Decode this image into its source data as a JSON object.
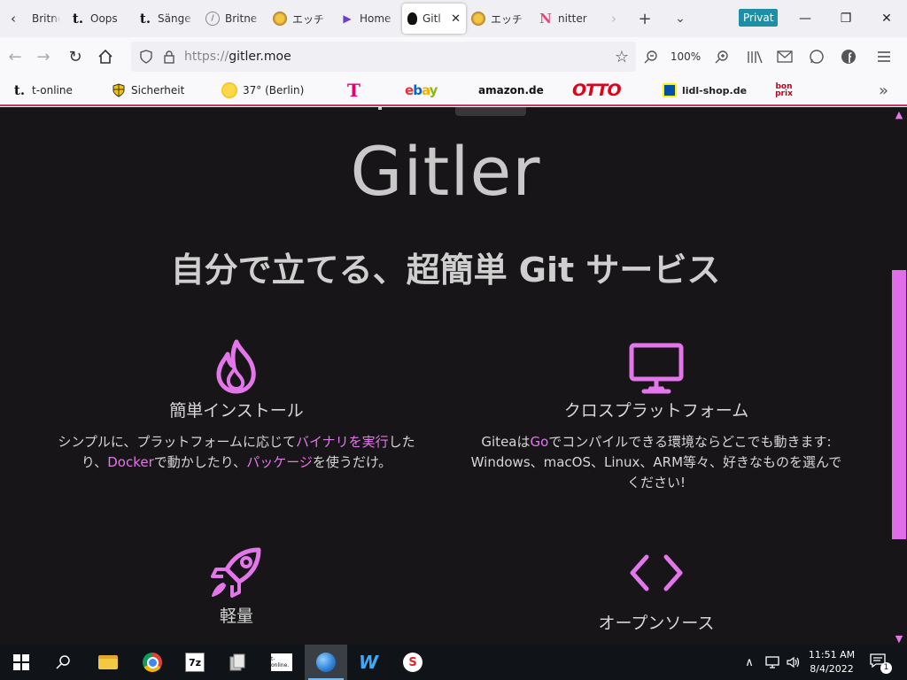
{
  "browser": {
    "tabs": [
      {
        "title": "Britne",
        "favicon": "tab-icon-britney",
        "active": false
      },
      {
        "title": "Oops",
        "favicon": "t-online-icon",
        "active": false
      },
      {
        "title": "Sänge",
        "favicon": "t-online-icon",
        "active": false
      },
      {
        "title": "Britne",
        "favicon": "circle-icon",
        "active": false
      },
      {
        "title": "エッチ",
        "favicon": "anime-icon",
        "active": false
      },
      {
        "title": "Home",
        "favicon": "play-icon",
        "active": false
      },
      {
        "title": "Gitl",
        "favicon": "tux-icon",
        "active": true
      },
      {
        "title": "エッチ",
        "favicon": "anime-icon",
        "active": false
      },
      {
        "title": "nitter",
        "favicon": "nitter-icon",
        "active": false
      }
    ],
    "new_tab_symbol": "+",
    "tab_list_symbol": "⌄",
    "private_badge": "Privat",
    "window_controls": {
      "minimize": "—",
      "restore": "❐",
      "close": "✕"
    },
    "url": {
      "protocol": "https://",
      "host": "gitler.moe"
    },
    "zoom": "100%",
    "bookmarks": [
      {
        "label": "t-online",
        "icon": "t-online-icon"
      },
      {
        "label": "Sicherheit",
        "icon": "shield-icon"
      },
      {
        "label": "37° (Berlin)",
        "icon": "weather-sun-icon"
      },
      {
        "label": "",
        "icon": "telekom-icon",
        "logo": "T"
      },
      {
        "label": "",
        "icon": "ebay-icon",
        "logo": "ebay"
      },
      {
        "label": "",
        "icon": "amazon-icon",
        "logo": "amazon.de"
      },
      {
        "label": "",
        "icon": "otto-icon",
        "logo": "OTTO"
      },
      {
        "label": "lidl-shop.de",
        "icon": "lidl-icon"
      },
      {
        "label": "",
        "icon": "bonprix-icon",
        "logo": "bon prix"
      }
    ],
    "bookmarks_overflow_symbol": "»"
  },
  "page": {
    "title": "Gitler",
    "tagline": "自分で立てる、超簡単 Git サービス",
    "accent_color": "#e276ea",
    "background_color": "#171517",
    "features": [
      {
        "icon": "flame-icon",
        "title": "簡単インストール",
        "desc": [
          {
            "text": "シンプルに、プラットフォームに応じて",
            "hl": false
          },
          {
            "text": "バイナリを実行",
            "hl": true
          },
          {
            "text": "したり、",
            "hl": false
          },
          {
            "text": "Docker",
            "hl": true
          },
          {
            "text": "で動かしたり、",
            "hl": false
          },
          {
            "text": "パッケージ",
            "hl": true
          },
          {
            "text": "を使うだけ。",
            "hl": false
          }
        ]
      },
      {
        "icon": "monitor-icon",
        "title": "クロスプラットフォーム",
        "desc": [
          {
            "text": "Giteaは",
            "hl": false
          },
          {
            "text": "Go",
            "hl": true
          },
          {
            "text": "でコンパイルできる環境ならどこでも動きます: Windows、macOS、Linux、ARM等々、好きなものを選んでください!",
            "hl": false
          }
        ]
      },
      {
        "icon": "rocket-icon",
        "title": "軽量",
        "desc": []
      },
      {
        "icon": "code-brackets-icon",
        "title": "オープンソース",
        "desc": []
      }
    ]
  },
  "taskbar": {
    "apps": [
      {
        "name": "start-button"
      },
      {
        "name": "search-icon"
      },
      {
        "name": "file-explorer-icon"
      },
      {
        "name": "chrome-icon"
      },
      {
        "name": "7zip-icon",
        "text": "7z"
      },
      {
        "name": "files-icon"
      },
      {
        "name": "t-online-app-icon",
        "text": "t-online."
      },
      {
        "name": "browser-globe-icon",
        "active": true
      },
      {
        "name": "ww-app-icon"
      },
      {
        "name": "s-app-icon",
        "text": "S"
      }
    ],
    "clock_time": "11:51 AM",
    "clock_date": "8/4/2022",
    "notification_count": "1"
  }
}
